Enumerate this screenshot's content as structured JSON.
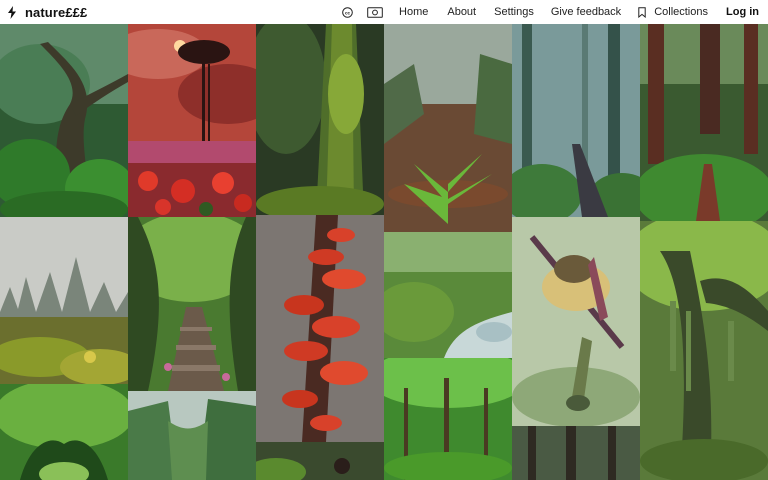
{
  "header": {
    "brand": "nature£££",
    "nav": {
      "home": "Home",
      "about": "About",
      "settings": "Settings",
      "feedback": "Give feedback",
      "collections": "Collections",
      "login": "Log in"
    },
    "icons": {
      "brand": "lightning-bolt-icon",
      "cc": "creative-commons-icon",
      "camera": "camera-icon",
      "collections": "bookmark-icon"
    }
  },
  "colors": {
    "header_bg": "#ffffff",
    "text": "#111111",
    "forest_green": "#3f7a2a",
    "moss": "#5a8a2e",
    "mushroom_red": "#c8351e",
    "sky_red": "#b84a3a"
  }
}
